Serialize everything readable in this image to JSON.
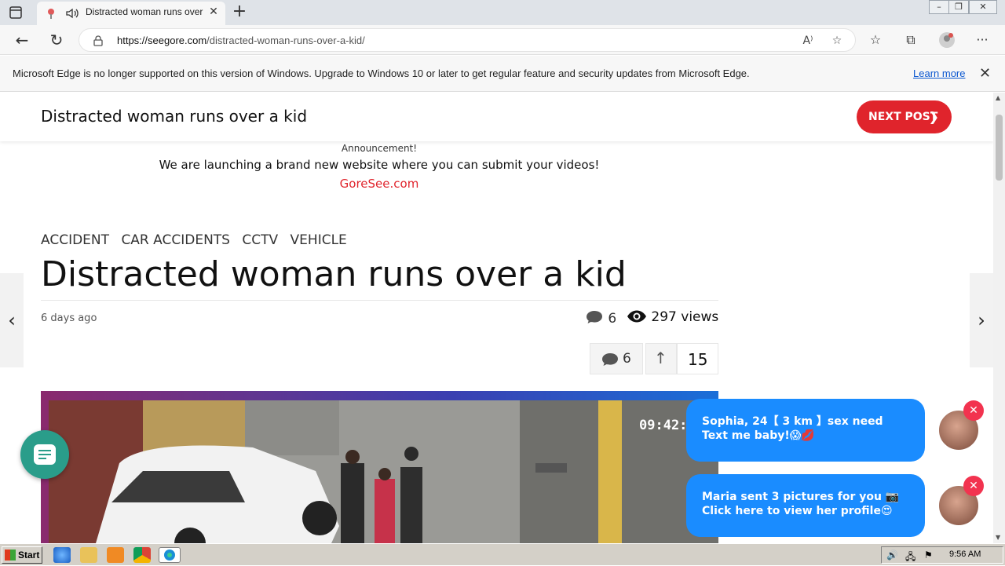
{
  "browser": {
    "tab_title": "Distracted woman runs over a kid",
    "url_host": "https://seegore.com",
    "url_path": "/distracted-woman-runs-over-a-kid/"
  },
  "infobar": {
    "message": "Microsoft Edge is no longer supported on this version of Windows. Upgrade to Windows 10 or later to get regular feature and security updates from Microsoft Edge.",
    "link": "Learn more"
  },
  "sticky_header": {
    "title": "Distracted woman runs over a kid",
    "next_post": "NEXT POST"
  },
  "announcement": {
    "label": "Announcement!",
    "text": "We are launching a brand new website where you can submit your videos!",
    "link": "GoreSee.com"
  },
  "article": {
    "categories": [
      "ACCIDENT",
      "CAR ACCIDENTS",
      "CCTV",
      "VEHICLE"
    ],
    "title": "Distracted woman runs over a kid",
    "date": "6 days ago",
    "comments": "6",
    "views": "297 views",
    "vote_comments": "6",
    "vote_score": "15"
  },
  "video": {
    "timestamp": "09:42:2"
  },
  "notifications": [
    {
      "text": "Sophia, 24【 3 km 】sex need Text me baby!😱💋"
    },
    {
      "text": "Maria sent 3 pictures for you 📷 Click here to view her profile😍"
    }
  ],
  "taskbar": {
    "start": "Start",
    "clock": "9:56 AM"
  },
  "colors": {
    "accent_red": "#e0242c",
    "notif_blue": "#1a8cff",
    "chat_green": "#2a9d8a"
  }
}
